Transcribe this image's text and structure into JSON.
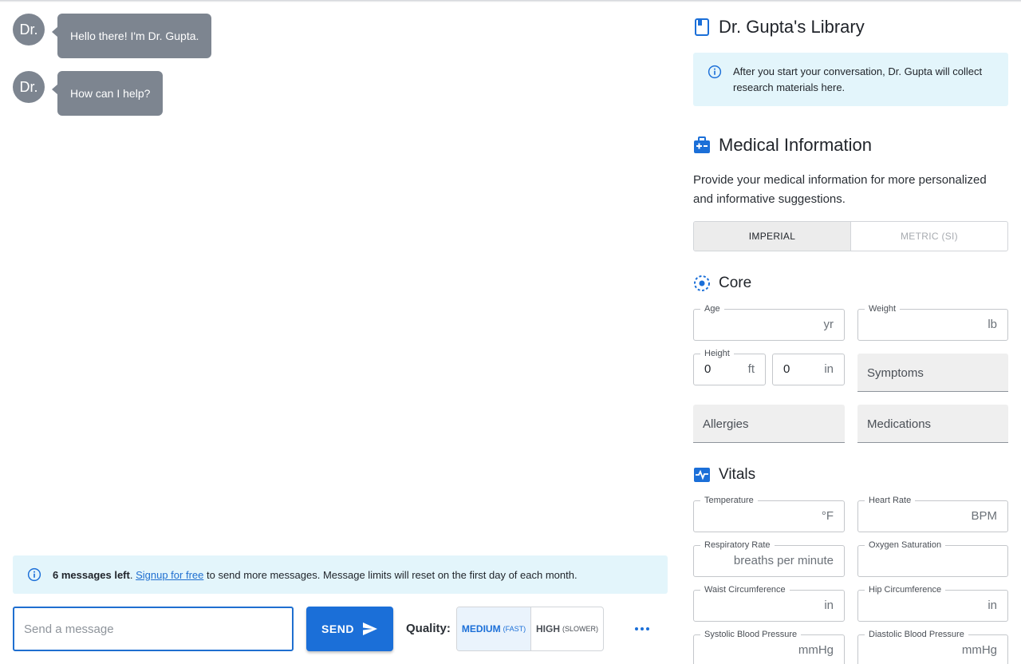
{
  "chat": {
    "messages": [
      {
        "avatar": "Dr.",
        "text": "Hello there! I'm Dr. Gupta."
      },
      {
        "avatar": "Dr.",
        "text": "How can I help?"
      }
    ],
    "limit_banner": {
      "count_text": "6 messages left",
      "period": ".",
      "signup_link": "Signup for free",
      "rest": " to send more messages. Message limits will reset on the first day of each month."
    },
    "input_placeholder": "Send a message",
    "send_label": "SEND",
    "quality": {
      "label": "Quality:",
      "options": [
        {
          "name": "MEDIUM",
          "hint": "(FAST)",
          "selected": true
        },
        {
          "name": "HIGH",
          "hint": "(SLOWER)",
          "selected": false
        }
      ]
    }
  },
  "library": {
    "title": "Dr. Gupta's Library",
    "note": "After you start your conversation, Dr. Gupta will collect research materials here."
  },
  "medical": {
    "title": "Medical Information",
    "description": "Provide your medical information for more personalized and informative suggestions.",
    "units": {
      "imperial": "IMPERIAL",
      "metric": "METRIC (SI)",
      "selected": "imperial"
    }
  },
  "core": {
    "title": "Core",
    "age": {
      "label": "Age",
      "unit": "yr",
      "value": ""
    },
    "weight": {
      "label": "Weight",
      "unit": "lb",
      "value": ""
    },
    "height": {
      "label": "Height",
      "ft_value": "0",
      "ft_unit": "ft",
      "in_value": "0",
      "in_unit": "in"
    },
    "symptoms": "Symptoms",
    "allergies": "Allergies",
    "medications": "Medications"
  },
  "vitals": {
    "title": "Vitals",
    "temperature": {
      "label": "Temperature",
      "unit": "°F"
    },
    "heart_rate": {
      "label": "Heart Rate",
      "unit": "BPM"
    },
    "respiratory_rate": {
      "label": "Respiratory Rate",
      "unit": "breaths per minute"
    },
    "oxygen_saturation": {
      "label": "Oxygen Saturation",
      "unit": ""
    },
    "waist": {
      "label": "Waist Circumference",
      "unit": "in"
    },
    "hip": {
      "label": "Hip Circumference",
      "unit": "in"
    },
    "systolic": {
      "label": "Systolic Blood Pressure",
      "unit": "mmHg"
    },
    "diastolic": {
      "label": "Diastolic Blood Pressure",
      "unit": "mmHg"
    }
  },
  "colors": {
    "accent": "#1b6fd8",
    "bubble": "#7d8590",
    "info_bg": "#e3f5fb"
  }
}
